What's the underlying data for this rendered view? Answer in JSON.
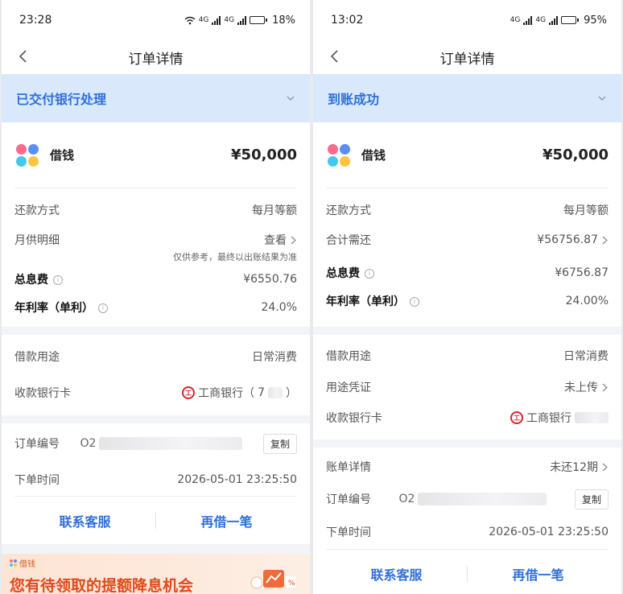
{
  "left": {
    "status": {
      "time": "23:28",
      "network": "4G",
      "battery": "18%",
      "battery_color": "#f5a623",
      "battery_fraction": 0.18
    },
    "nav": {
      "title": "订单详情"
    },
    "status_band": "已交付银行处理",
    "product": {
      "name": "借钱",
      "amount": "¥50,000"
    },
    "repay_method": {
      "label": "还款方式",
      "value": "每月等额"
    },
    "monthly": {
      "label": "月供明细",
      "value": "查看",
      "note": "仅供参考，最终以出账结果为准"
    },
    "interest": {
      "label": "总息费",
      "value": "¥6550.76"
    },
    "rate": {
      "label": "年利率（单利）",
      "value": "24.0%"
    },
    "purpose": {
      "label": "借款用途",
      "value": "日常消费"
    },
    "bank": {
      "label": "收款银行卡",
      "value": "工商银行（",
      "suffix": "）",
      "masked": "7"
    },
    "order_no": {
      "label": "订单编号",
      "prefix": "O2",
      "copy": "复制"
    },
    "order_time": {
      "label": "下单时间",
      "value": "2026-05-01 23:25:50"
    },
    "actions": {
      "service": "联系客服",
      "again": "再借一笔"
    },
    "promo": {
      "brand": "借钱",
      "headline": "您有待领取的提额降息机会"
    }
  },
  "right": {
    "status": {
      "time": "13:02",
      "network": "4G",
      "battery": "95%",
      "battery_color": "#222222",
      "battery_fraction": 0.95
    },
    "nav": {
      "title": "订单详情"
    },
    "status_band": "到账成功",
    "product": {
      "name": "借钱",
      "amount": "¥50,000"
    },
    "repay_method": {
      "label": "还款方式",
      "value": "每月等额"
    },
    "total_due": {
      "label": "合计需还",
      "value": "¥56756.87"
    },
    "interest": {
      "label": "总息费",
      "value": "¥6756.87"
    },
    "rate": {
      "label": "年利率（单利）",
      "value": "24.00%"
    },
    "purpose": {
      "label": "借款用途",
      "value": "日常消费"
    },
    "voucher": {
      "label": "用途凭证",
      "value": "未上传"
    },
    "bank": {
      "label": "收款银行卡",
      "value": "工商银行"
    },
    "bill": {
      "label": "账单详情",
      "value": "未还12期"
    },
    "order_no": {
      "label": "订单编号",
      "prefix": "O2",
      "copy": "复制"
    },
    "order_time": {
      "label": "下单时间",
      "value": "2026-05-01 23:25:50"
    },
    "actions": {
      "service": "联系客服",
      "again": "再借一笔"
    }
  }
}
